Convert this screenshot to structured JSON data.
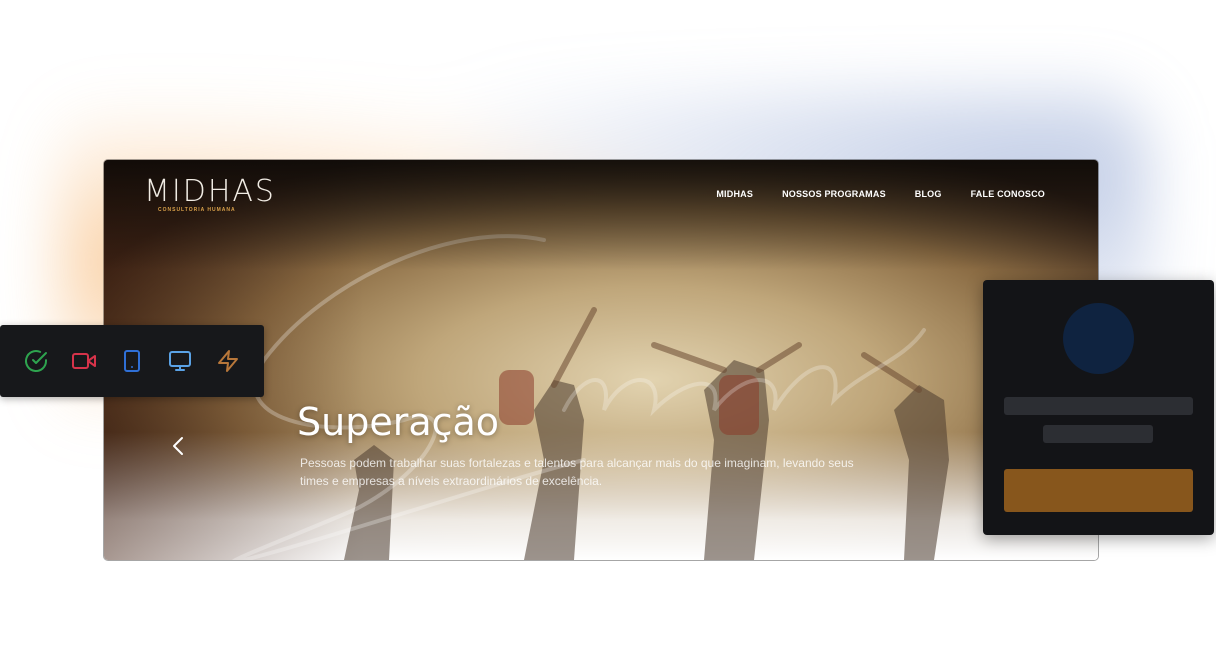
{
  "site": {
    "logo": {
      "text": "MIDHAS",
      "subtitle": "CONSULTORIA HUMANA"
    },
    "nav": [
      {
        "label": "MIDHAS"
      },
      {
        "label": "NOSSOS PROGRAMAS"
      },
      {
        "label": "BLOG"
      },
      {
        "label": "FALE CONOSCO"
      }
    ],
    "hero": {
      "title": "Superação",
      "description": "Pessoas podem trabalhar suas fortalezas e talentos para alcançar mais do que imaginam, levando seus times e empresas a níveis extraordinários de excelência."
    }
  },
  "icon_toolbar": {
    "icons": [
      {
        "name": "check-circle-icon",
        "color": "#2ea44f"
      },
      {
        "name": "video-camera-icon",
        "color": "#d6334a"
      },
      {
        "name": "smartphone-icon",
        "color": "#2f6fd6"
      },
      {
        "name": "monitor-icon",
        "color": "#5aa2e6"
      },
      {
        "name": "lightning-icon",
        "color": "#b8773a"
      }
    ]
  },
  "profile_card": {
    "avatar_color": "#0f2340",
    "button_color": "#87561c"
  },
  "colors": {
    "nav_text": "#ffffff",
    "logo_accent": "#d9a14a",
    "panel_bg": "#17181b"
  }
}
